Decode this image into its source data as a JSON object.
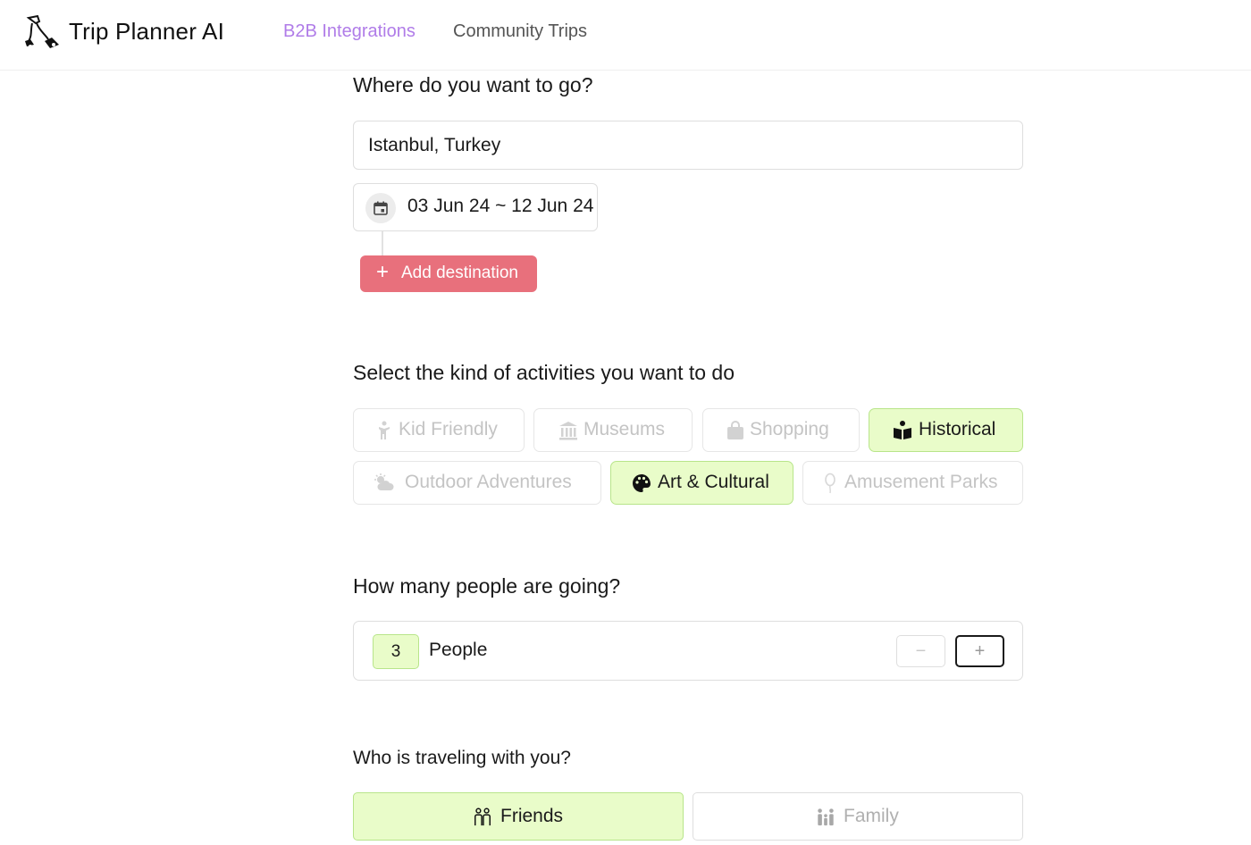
{
  "header": {
    "brand": "Trip Planner AI",
    "nav": [
      "B2B Integrations",
      "Community Trips"
    ]
  },
  "colors": {
    "accent_purple": "#b07ce8",
    "add_button": "#e8707c",
    "selected_bg": "#e9fcc9",
    "selected_border": "#b8e58a"
  },
  "destination": {
    "title": "Where do you want to go?",
    "value": "Istanbul, Turkey",
    "dates": "03 Jun 24 ~ 12 Jun 24",
    "add_label": "Add destination",
    "add_icon": "plus-icon",
    "date_icon": "calendar-icon"
  },
  "activities": {
    "title": "Select the kind of activities you want to do",
    "items": [
      {
        "label": "Kid Friendly",
        "icon": "child-icon",
        "selected": false
      },
      {
        "label": "Museums",
        "icon": "museum-icon",
        "selected": false
      },
      {
        "label": "Shopping",
        "icon": "shopping-bag-icon",
        "selected": false
      },
      {
        "label": "Historical",
        "icon": "book-reader-icon",
        "selected": true
      },
      {
        "label": "Outdoor Adventures",
        "icon": "weather-icon",
        "selected": false
      },
      {
        "label": "Art & Cultural",
        "icon": "palette-icon",
        "selected": true
      },
      {
        "label": "Amusement Parks",
        "icon": "balloon-icon",
        "selected": false
      }
    ]
  },
  "people": {
    "title": "How many people are going?",
    "count": "3",
    "label": "People",
    "minus": "−",
    "plus": "+"
  },
  "companions": {
    "title": "Who is traveling with you?",
    "options": [
      {
        "label": "Friends",
        "icon": "friends-icon",
        "selected": true
      },
      {
        "label": "Family",
        "icon": "family-icon",
        "selected": false
      }
    ]
  }
}
